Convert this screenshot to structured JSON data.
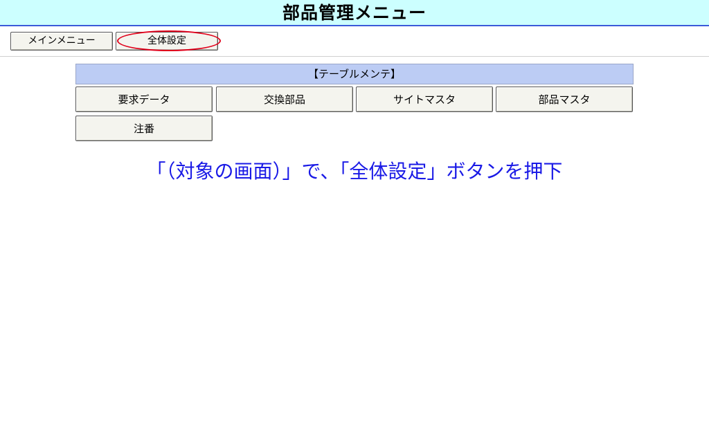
{
  "header": {
    "title": "部品管理メニュー"
  },
  "top_nav": {
    "menu_label": "メインメニュー",
    "global_settings_label": "全体設定"
  },
  "table_maintenance": {
    "header": "【テーブルメンテ】",
    "buttons": [
      {
        "label": "要求データ"
      },
      {
        "label": "交換部品"
      },
      {
        "label": "サイトマスタ"
      },
      {
        "label": "部品マスタ"
      },
      {
        "label": "注番"
      }
    ]
  },
  "instruction": {
    "text": "「（対象の画面）」で、「全体設定」ボタンを押下"
  },
  "colors": {
    "title_bg": "#ccffff",
    "title_border": "#3a5ad9",
    "section_header_bg": "#bcccf4",
    "highlight": "#e0001a",
    "instruction_text": "#1a1ae6"
  }
}
